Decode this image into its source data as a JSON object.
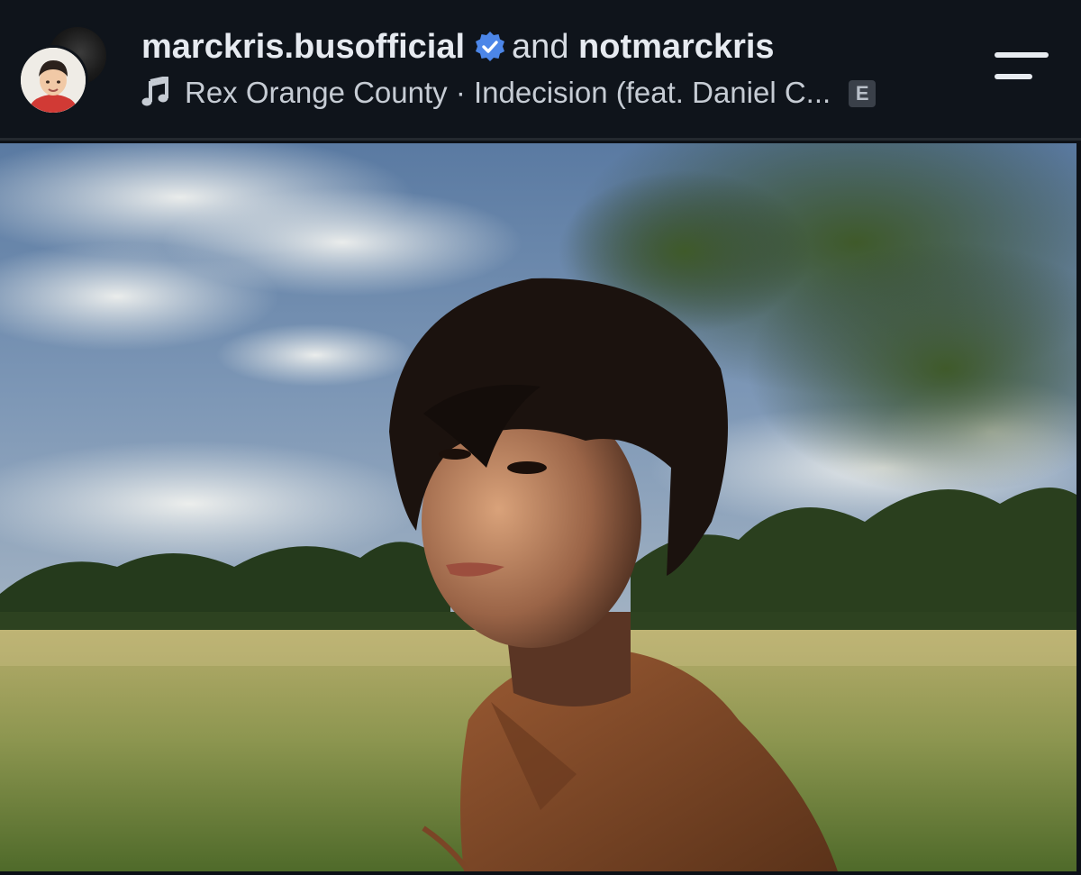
{
  "header": {
    "user1": "marckris.busofficial",
    "connector": "and",
    "user2": "notmarckris",
    "song": "Rex Orange County · Indecision (feat. Daniel C...",
    "explicit_label": "E"
  },
  "icons": {
    "verified": "verified-badge-icon",
    "music": "music-note-icon",
    "menu": "menu-icon"
  },
  "colors": {
    "verified_blue": "#4c86e8",
    "header_bg": "#0f141b"
  }
}
